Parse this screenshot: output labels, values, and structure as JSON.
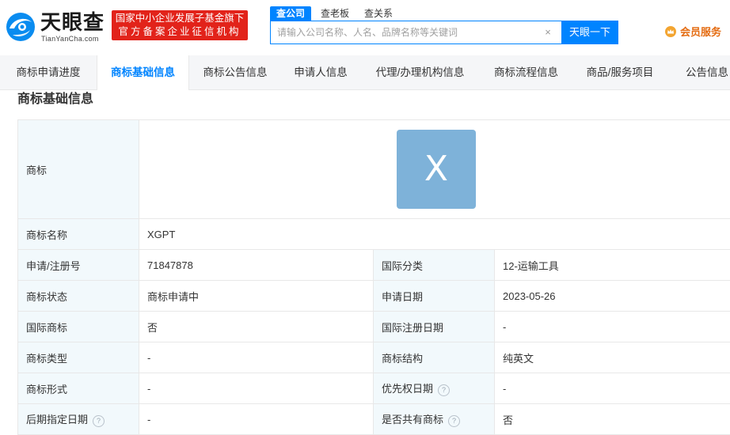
{
  "brand": {
    "name": "天眼查",
    "domain": "TianYanCha.com"
  },
  "badge": {
    "line1": "国家中小企业发展子基金旗下",
    "line2": "官方备案企业征信机构"
  },
  "search": {
    "tabs": [
      {
        "label": "查公司",
        "active": true
      },
      {
        "label": "查老板",
        "active": false
      },
      {
        "label": "查关系",
        "active": false
      }
    ],
    "placeholder": "请输入公司名称、人名、品牌名称等关键词",
    "value": "",
    "clear_icon": "×",
    "button_label": "天眼一下"
  },
  "member": {
    "label": "会员服务",
    "icon": "crown-icon",
    "color": "#e46b10"
  },
  "nav": {
    "tabs": [
      {
        "label": "商标申请进度",
        "active": false
      },
      {
        "label": "商标基础信息",
        "active": true
      },
      {
        "label": "商标公告信息",
        "active": false
      },
      {
        "label": "申请人信息",
        "active": false
      },
      {
        "label": "代理/办理机构信息",
        "active": false
      },
      {
        "label": "商标流程信息",
        "active": false
      },
      {
        "label": "商品/服务项目",
        "active": false
      },
      {
        "label": "公告信息",
        "active": false
      }
    ]
  },
  "section": {
    "title": "商标基础信息"
  },
  "trademark": {
    "logo_label": "商标",
    "logo_text": "X",
    "name_label": "商标名称",
    "name_value": "XGPT",
    "rows": [
      {
        "l1": "申请/注册号",
        "v1": "71847878",
        "l2": "国际分类",
        "v2": "12-运输工具",
        "help1": false,
        "help2": false
      },
      {
        "l1": "商标状态",
        "v1": "商标申请中",
        "l2": "申请日期",
        "v2": "2023-05-26",
        "help1": false,
        "help2": false
      },
      {
        "l1": "国际商标",
        "v1": "否",
        "l2": "国际注册日期",
        "v2": "-",
        "help1": false,
        "help2": false
      },
      {
        "l1": "商标类型",
        "v1": "-",
        "l2": "商标结构",
        "v2": "纯英文",
        "help1": false,
        "help2": false
      },
      {
        "l1": "商标形式",
        "v1": "-",
        "l2": "优先权日期",
        "v2": "-",
        "help1": false,
        "help2": true
      },
      {
        "l1": "后期指定日期",
        "v1": "-",
        "l2": "是否共有商标",
        "v2": "否",
        "help1": true,
        "help2": true
      }
    ]
  },
  "colors": {
    "accent": "#0084ff",
    "badge_red": "#e2231a",
    "label_bg": "#f2f9fc",
    "logo_tile": "#7eb2d9"
  }
}
